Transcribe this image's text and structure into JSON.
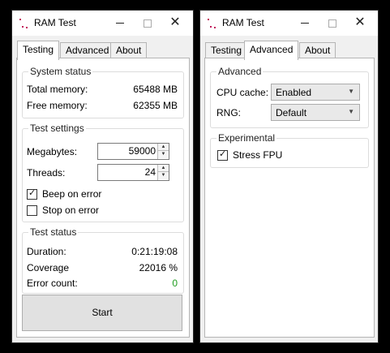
{
  "windows": {
    "left": {
      "title": "RAM Test",
      "tabs": [
        {
          "label": "Testing",
          "active": true
        },
        {
          "label": "Advanced",
          "active": false
        },
        {
          "label": "About",
          "active": false
        }
      ],
      "system_status": {
        "title": "System status",
        "total_memory_label": "Total memory:",
        "total_memory_value": "65488 MB",
        "free_memory_label": "Free memory:",
        "free_memory_value": "62355 MB"
      },
      "test_settings": {
        "title": "Test settings",
        "megabytes_label": "Megabytes:",
        "megabytes_value": "59000",
        "threads_label": "Threads:",
        "threads_value": "24",
        "beep_on_error_label": "Beep on error",
        "beep_on_error_checked": true,
        "stop_on_error_label": "Stop on error",
        "stop_on_error_checked": false
      },
      "test_status": {
        "title": "Test status",
        "duration_label": "Duration:",
        "duration_value": "0:21:19:08",
        "coverage_label": "Coverage",
        "coverage_value": "22016 %",
        "error_count_label": "Error count:",
        "error_count_value": "0"
      },
      "start_button": "Start"
    },
    "right": {
      "title": "RAM Test",
      "tabs": [
        {
          "label": "Testing",
          "active": false
        },
        {
          "label": "Advanced",
          "active": true
        },
        {
          "label": "About",
          "active": false
        }
      ],
      "advanced": {
        "title": "Advanced",
        "cpu_cache_label": "CPU cache:",
        "cpu_cache_value": "Enabled",
        "rng_label": "RNG:",
        "rng_value": "Default"
      },
      "experimental": {
        "title": "Experimental",
        "stress_fpu_label": "Stress FPU",
        "stress_fpu_checked": true
      }
    }
  },
  "colors": {
    "error_count_ok": "#1e9c1e",
    "app_icon": "#c2185b"
  },
  "icons": {
    "check": "✓",
    "close": "✕",
    "spin_up": "▲",
    "spin_down": "▼",
    "dropdown": "▼"
  }
}
